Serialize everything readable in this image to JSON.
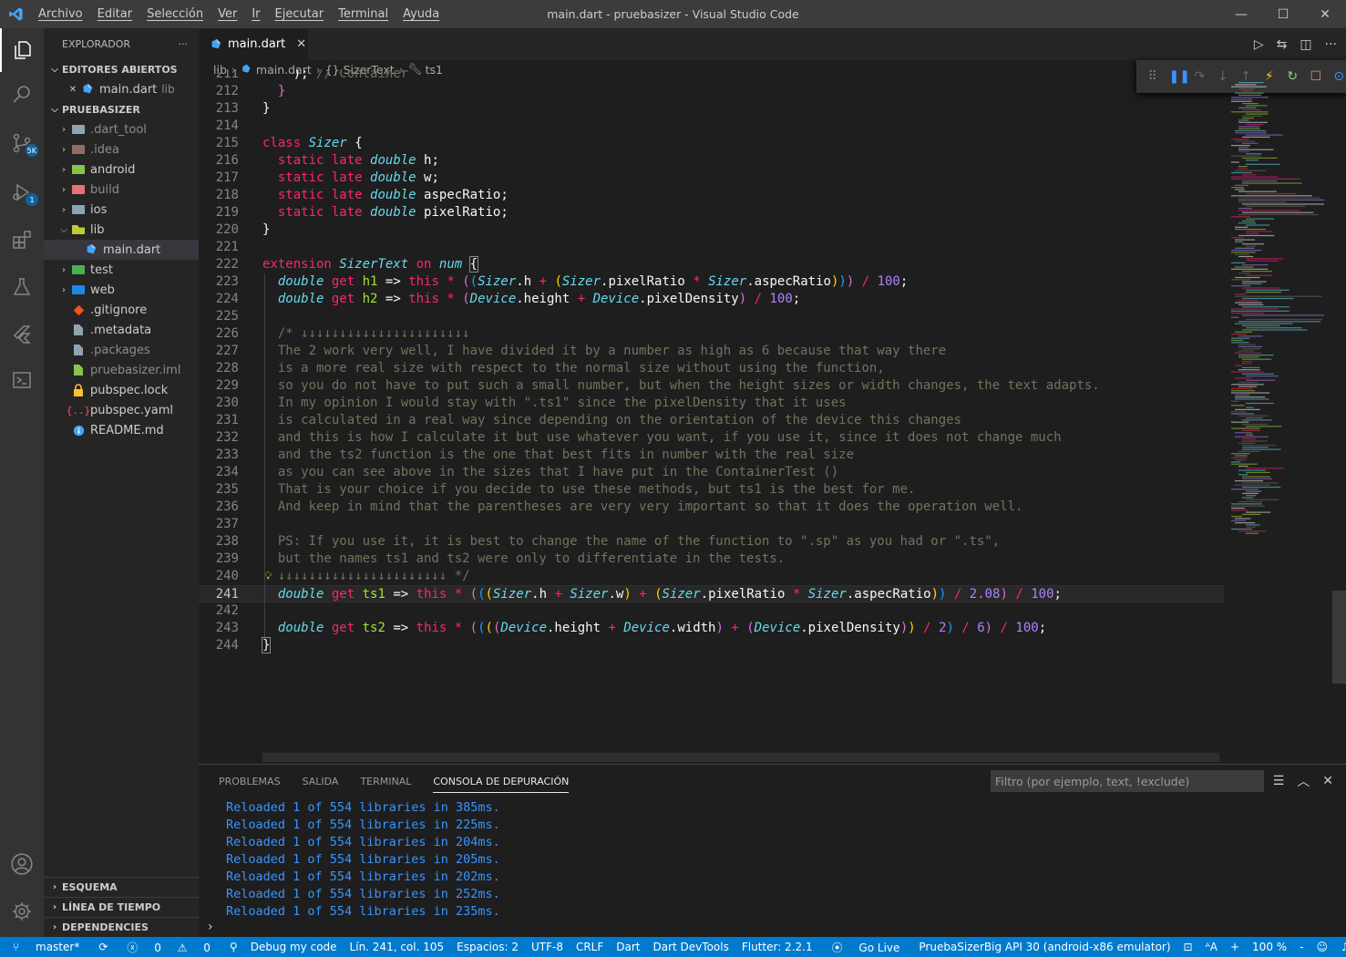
{
  "titlebar": {
    "menu": [
      "Archivo",
      "Editar",
      "Selección",
      "Ver",
      "Ir",
      "Ejecutar",
      "Terminal",
      "Ayuda"
    ],
    "title": "main.dart - pruebasizer - Visual Studio Code",
    "minimize": "—",
    "maximize": "☐",
    "close": "✕"
  },
  "activity": {
    "scm_badge": "5K",
    "debug_badge": "1"
  },
  "sidebar": {
    "title": "EXPLORADOR",
    "more": "···",
    "open_editors_title": "EDITORES ABIERTOS",
    "open_editor": {
      "name": "main.dart",
      "folder": "lib"
    },
    "project_title": "PRUEBASIZER",
    "tree": [
      {
        "name": ".dart_tool",
        "kind": "folder",
        "color": "#90a4ae",
        "muted": true
      },
      {
        "name": ".idea",
        "kind": "folder",
        "color": "#8d6e63",
        "muted": true
      },
      {
        "name": "android",
        "kind": "folder",
        "color": "#8bc34a",
        "muted": false
      },
      {
        "name": "build",
        "kind": "folder",
        "color": "#e57373",
        "muted": true
      },
      {
        "name": "ios",
        "kind": "folder",
        "color": "#90a4ae",
        "muted": false
      },
      {
        "name": "lib",
        "kind": "folder-open",
        "color": "#c0ca33",
        "muted": false
      },
      {
        "name": "main.dart",
        "kind": "dart",
        "color": "#42a5f5",
        "muted": false
      },
      {
        "name": "test",
        "kind": "folder",
        "color": "#4caf50",
        "muted": false
      },
      {
        "name": "web",
        "kind": "folder",
        "color": "#1e88e5",
        "muted": false
      },
      {
        "name": ".gitignore",
        "kind": "git",
        "color": "#f4511e",
        "muted": false
      },
      {
        "name": ".metadata",
        "kind": "file",
        "color": "#90a4ae",
        "muted": false
      },
      {
        "name": ".packages",
        "kind": "file",
        "color": "#90a4ae",
        "muted": true
      },
      {
        "name": "pruebasizer.iml",
        "kind": "file",
        "color": "#8bc34a",
        "muted": true
      },
      {
        "name": "pubspec.lock",
        "kind": "lock",
        "color": "#fbc02d",
        "muted": false
      },
      {
        "name": "pubspec.yaml",
        "kind": "yaml",
        "color": "#ff5252",
        "muted": false
      },
      {
        "name": "README.md",
        "kind": "info",
        "color": "#42a5f5",
        "muted": false
      }
    ],
    "bottom_sections": [
      "ESQUEMA",
      "LÍNEA DE TIEMPO",
      "DEPENDENCIES"
    ]
  },
  "tab": {
    "label": "main.dart",
    "close": "✕"
  },
  "breadcrumb": [
    "lib",
    "main.dart",
    "{} SizerText",
    "ts1"
  ],
  "code": {
    "line_numbers": [
      "211",
      "212",
      "213",
      "214",
      "215",
      "216",
      "217",
      "218",
      "219",
      "220",
      "221",
      "222",
      "223",
      "224",
      "225",
      "226",
      "227",
      "228",
      "229",
      "230",
      "231",
      "232",
      "233",
      "234",
      "235",
      "236",
      "237",
      "238",
      "239",
      "240",
      "241",
      "242",
      "243",
      "244"
    ],
    "comment_lines": [
      "/* ↓↓↓↓↓↓↓↓↓↓↓↓↓↓↓↓↓↓↓↓↓↓",
      "The 2 work very well, I have divided it by a number as high as 6 because that way there",
      "is a more real size with respect to the normal size without using the function,",
      "so you do not have to put such a small number, but when the height sizes or width changes, the text adapts.",
      "In my opinion I would stay with \".ts1\" since the pixelDensity that it uses",
      "is calculated in a real way since depending on the orientation of the device this changes",
      "and this is how I calculate it but use whatever you want, if you use it, since it does not change much",
      "and the ts2 function is the one that best fits in number with the real size",
      "as you can see above in the sizes that I have put in the ContainerTest ()",
      "That is your choice if you decide to use these methods, but ts1 is the best for me.",
      "And keep in mind that the parentheses are very very important so that it does the operation well.",
      "",
      "PS: If you use it, it is best to change the name of the function to \".sp\" as you had or \".ts\",",
      "but the names ts1 and ts2 were only to differentiate in the tests.",
      "↓↓↓↓↓↓↓↓↓↓↓↓↓↓↓↓↓↓↓↓↓↓ */"
    ],
    "container_comment": "// Container"
  },
  "panel": {
    "tabs": [
      "PROBLEMAS",
      "SALIDA",
      "TERMINAL",
      "CONSOLA DE DEPURACIÓN"
    ],
    "filter_placeholder": "Filtro (por ejemplo, text, !exclude)",
    "output": [
      "Reloaded 1 of 554 libraries in 385ms.",
      "Reloaded 1 of 554 libraries in 225ms.",
      "Reloaded 1 of 554 libraries in 204ms.",
      "Reloaded 1 of 554 libraries in 205ms.",
      "Reloaded 1 of 554 libraries in 202ms.",
      "Reloaded 1 of 554 libraries in 252ms.",
      "Reloaded 1 of 554 libraries in 235ms."
    ],
    "prompt": "›"
  },
  "statusbar": {
    "branch": "master*",
    "errors": "0",
    "warnings": "0",
    "debug": "Debug my code",
    "position": "Lín. 241, col. 105",
    "spaces": "Espacios: 2",
    "encoding": "UTF-8",
    "eol": "CRLF",
    "language": "Dart",
    "devtools": "Dart DevTools",
    "flutter": "Flutter: 2.2.1",
    "golive": "Go Live",
    "device": "PruebaSizerBig API 30 (android-x86 emulator)",
    "aa": "ᴬA",
    "plus": "+",
    "zoom": "100 %",
    "minus": "-"
  }
}
